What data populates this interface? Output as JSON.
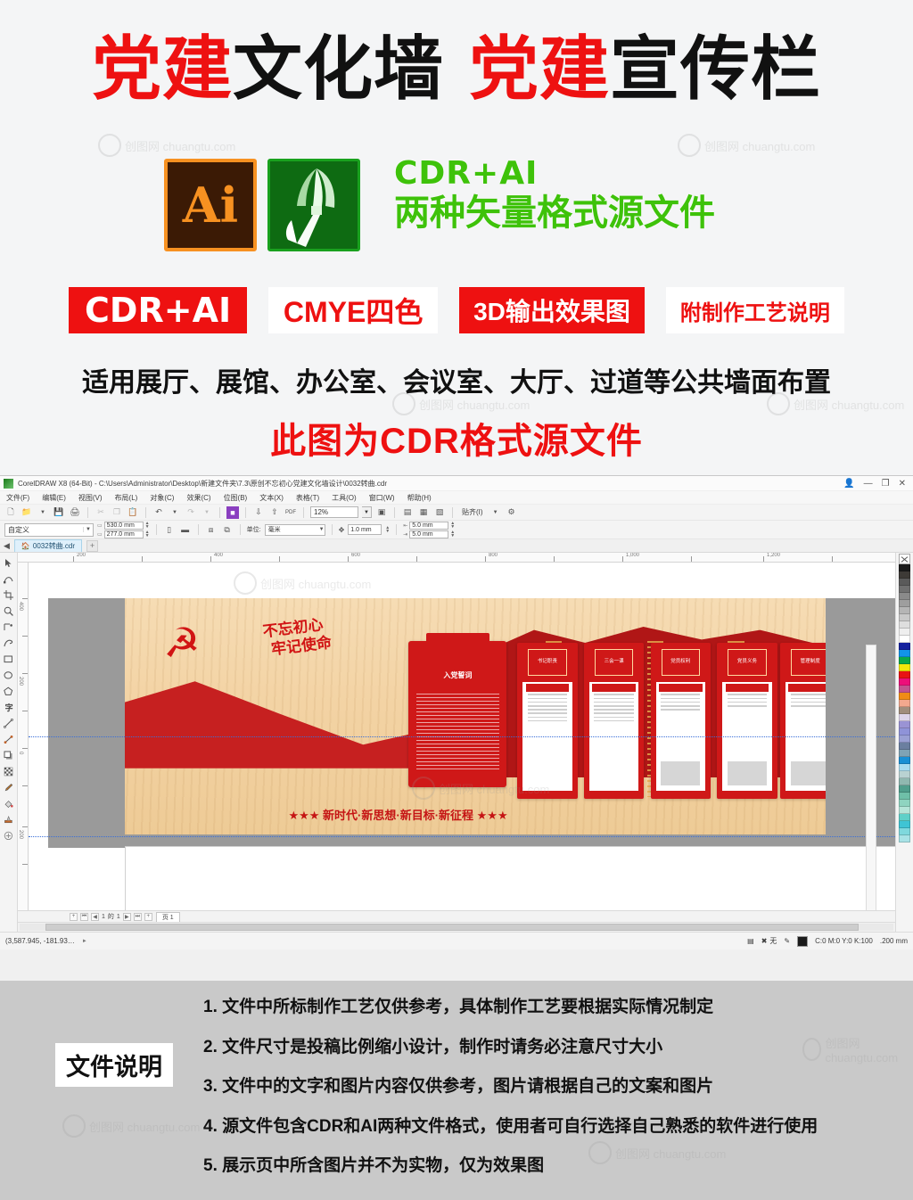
{
  "promo": {
    "title_parts": [
      {
        "text": "党建",
        "color": "red"
      },
      {
        "text": "文化墙",
        "color": "black"
      },
      {
        "text": "党建",
        "color": "red"
      },
      {
        "text": "宣传栏",
        "color": "black"
      }
    ],
    "ai_icon_label": "Ai",
    "green_line1": "CDR+AI",
    "green_line2": "两种矢量格式源文件",
    "badges": [
      {
        "label": "CDR+AI",
        "style": "fill"
      },
      {
        "label": "CMYE四色",
        "style": "outline"
      },
      {
        "label": "3D输出效果图",
        "style": "fill"
      },
      {
        "label": "附制作工艺说明",
        "style": "outline"
      }
    ],
    "apply_line": "适用展厅、展馆、办公室、会议室、大厅、过道等公共墙面布置",
    "cdr_line": "此图为CDR格式源文件",
    "watermark": "创图网 chuangtu.com",
    "accent_red": "#ee1111",
    "accent_green": "#3ec20a"
  },
  "app": {
    "title": "CorelDRAW X8 (64-Bit) - C:\\Users\\Administrator\\Desktop\\新建文件夹\\7.3\\原创不忘初心党建文化墙设计\\0032转曲.cdr",
    "window_buttons": {
      "minimize": "—",
      "restore": "❐",
      "close": "✕"
    },
    "menus": [
      "文件(F)",
      "编辑(E)",
      "视图(V)",
      "布局(L)",
      "对象(C)",
      "效果(C)",
      "位图(B)",
      "文本(X)",
      "表格(T)",
      "工具(O)",
      "窗口(W)",
      "帮助(H)"
    ],
    "toolbar": {
      "zoom_level": "12%",
      "snap_label": "贴齐(I)"
    },
    "property_bar": {
      "preset": "自定义",
      "page_width": "530.0 mm",
      "page_height": "277.0 mm",
      "unit_label": "单位:",
      "unit_value": "毫米",
      "nudge": "1.0 mm",
      "duplicate_x": "5.0 mm",
      "duplicate_y": "5.0 mm"
    },
    "document_tab": "0032转曲.cdr",
    "tab_add": "+",
    "page_nav": {
      "current": "1",
      "of_label": "的",
      "total": "1",
      "page_tab": "页 1"
    },
    "status": {
      "coords": "(3,587.945, -181.93…",
      "fill_label": "无",
      "outline_color": "C:0 M:0 Y:0 K:100",
      "outline_width": ".200 mm"
    },
    "rulers": {
      "h_labels": [
        "200",
        "400",
        "600",
        "800",
        "1,000",
        "1,200"
      ],
      "v_labels": [
        "400",
        "200",
        "0",
        "200"
      ]
    }
  },
  "artwork": {
    "emblem": "☭",
    "calligraphy_line1": "不忘初心",
    "calligraphy_line2": "牢记使命",
    "oath_title": "入党誓词",
    "slogan": "★★★ 新时代·新思想·新目标·新征程 ★★★",
    "panels": [
      {
        "title_line1": "书记",
        "title_line2": "职责"
      },
      {
        "title_line1": "三会",
        "title_line2": "一课"
      },
      {
        "title_line1": "党员",
        "title_line2": "权利"
      },
      {
        "title_line1": "党员",
        "title_line2": "义务"
      },
      {
        "title_line1": "管理",
        "title_line2": "制度"
      }
    ]
  },
  "notes": {
    "tag": "文件说明",
    "items": [
      "1. 文件中所标制作工艺仅供参考，具体制作工艺要根据实际情况制定",
      "2. 文件尺寸是投稿比例缩小设计，制作时请务必注意尺寸大小",
      "3. 文件中的文字和图片内容仅供参考，图片请根据自己的文案和图片",
      "4. 源文件包含CDR和AI两种文件格式，使用者可自行选择自己熟悉的软件进行使用",
      "5. 展示页中所含图片并不为实物，仅为效果图"
    ]
  }
}
